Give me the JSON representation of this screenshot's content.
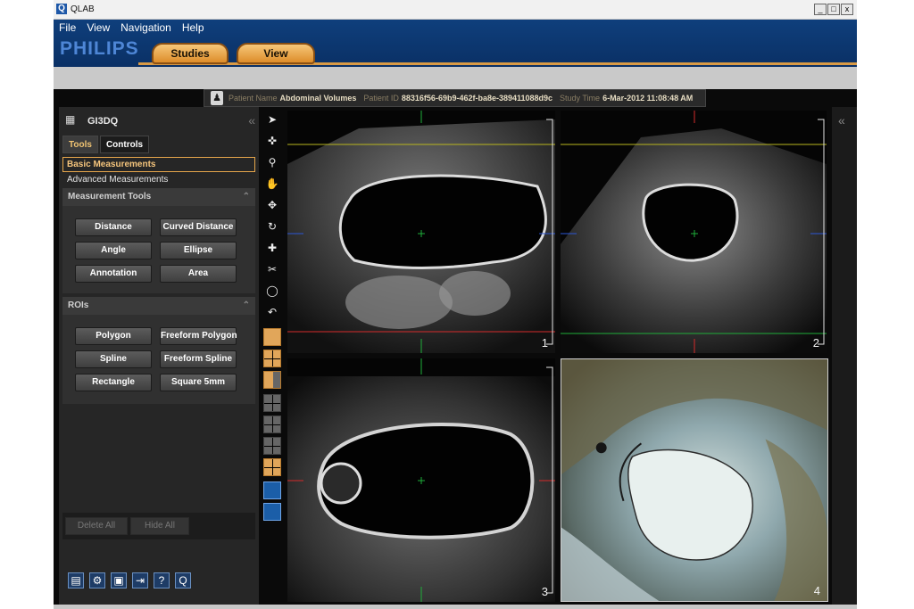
{
  "window": {
    "title": "QLAB",
    "app_icon_letter": "Q",
    "buttons": [
      "_",
      "□",
      "x"
    ]
  },
  "menu": [
    "File",
    "View",
    "Navigation",
    "Help"
  ],
  "brand": "PHILIPS",
  "top_tabs": {
    "studies": "Studies",
    "view": "View"
  },
  "patient": {
    "name_label": "Patient Name",
    "name": "Abdominal Volumes",
    "id_label": "Patient ID",
    "id": "88316f56-69b9-462f-ba8e-389411088d9c",
    "time_label": "Study Time",
    "time": "6-Mar-2012 11:08:48 AM"
  },
  "left_panel": {
    "title": "GI3DQ",
    "collapse_glyph": "«",
    "tabs": [
      "Tools",
      "Controls"
    ],
    "modes": [
      "Basic Measurements",
      "Advanced Measurements"
    ],
    "measurement_tools": {
      "title": "Measurement Tools",
      "buttons": [
        "Distance",
        "Curved Distance",
        "Angle",
        "Ellipse",
        "Annotation",
        "Area"
      ]
    },
    "rois": {
      "title": "ROIs",
      "buttons": [
        "Polygon",
        "Freeform Polygon",
        "Spline",
        "Freeform Spline",
        "Rectangle",
        "Square 5mm"
      ]
    },
    "bottom_buttons": {
      "delete_all": "Delete All",
      "hide_all": "Hide All"
    },
    "bottom_icons": [
      "film-icon",
      "gear-icon",
      "save-icon",
      "export-icon",
      "help-icon",
      "qlab-icon"
    ]
  },
  "viewports": {
    "vp1": "1",
    "vp2": "2",
    "vp3": "3",
    "vp4": "4"
  },
  "right_panel": {
    "collapse_glyph": "«"
  },
  "colors": {
    "accent": "#e6a64b",
    "menu_blue": "#0f3f7c",
    "axis_yellow": "#b9b61e",
    "axis_red": "#d42a2a",
    "axis_green": "#1fae3a",
    "axis_blue": "#2c56d6"
  }
}
